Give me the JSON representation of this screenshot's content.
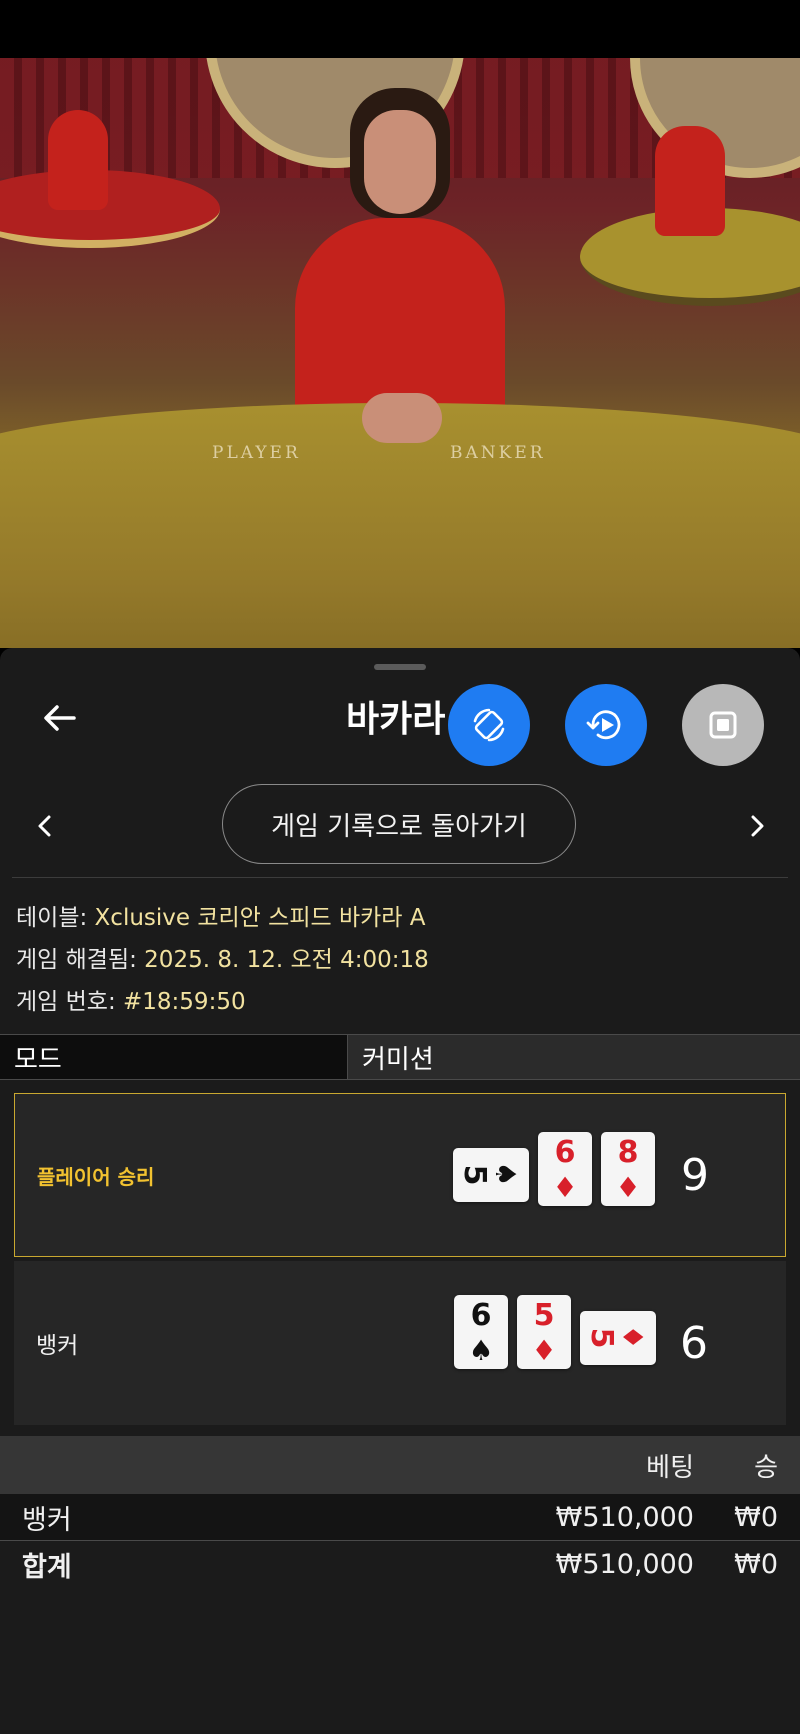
{
  "video": {
    "table_label_player": "PLAYER",
    "table_label_banker": "BANKER"
  },
  "header": {
    "title": "바카라"
  },
  "buttons": {
    "return_label": "게임 기록으로 돌아가기"
  },
  "game_info": {
    "table_label": "테이블: ",
    "table_value": "Xclusive 코리안 스피드 바카라 A",
    "resolved_label": "게임 해결됨: ",
    "resolved_value": "2025. 8. 12. 오전 4:00:18",
    "number_label": "게임 번호: ",
    "number_value": "#18:59:50"
  },
  "mode": {
    "label": "모드",
    "value": "커미션"
  },
  "results": {
    "player": {
      "label": "플레이어 승리",
      "score": "9",
      "cards": [
        {
          "rank": "5",
          "suit": "♠",
          "color": "black",
          "orientation": "side"
        },
        {
          "rank": "6",
          "suit": "♦",
          "color": "red",
          "orientation": "upright"
        },
        {
          "rank": "8",
          "suit": "♦",
          "color": "red",
          "orientation": "upright"
        }
      ]
    },
    "banker": {
      "label": "뱅커",
      "score": "6",
      "cards": [
        {
          "rank": "6",
          "suit": "♠",
          "color": "black",
          "orientation": "upright"
        },
        {
          "rank": "5",
          "suit": "♦",
          "color": "red",
          "orientation": "upright"
        },
        {
          "rank": "5",
          "suit": "♦",
          "color": "red",
          "orientation": "side"
        }
      ]
    }
  },
  "bets_table": {
    "headers": {
      "bet": "베팅",
      "win": "승"
    },
    "rows": [
      {
        "name": "뱅커",
        "bet": "₩510,000",
        "win": "₩0"
      }
    ],
    "total": {
      "name": "합계",
      "bet": "₩510,000",
      "win": "₩0"
    }
  },
  "colors": {
    "accent_blue": "#1f7cf2",
    "player_win_gold": "#f2c230",
    "info_value": "#f2e2a0",
    "card_red": "#d8202a"
  },
  "icons": {
    "back": "arrow-left-icon",
    "rotate": "rotate-screen-icon",
    "replay": "replay-icon",
    "stop": "stop-icon",
    "prev": "chevron-left-icon",
    "next": "chevron-right-icon"
  }
}
